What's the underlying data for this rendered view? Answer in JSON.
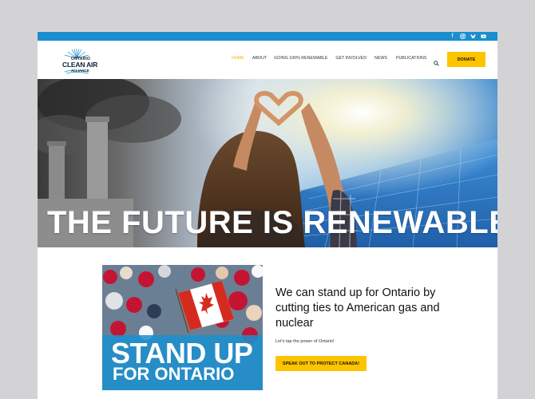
{
  "social": {
    "icons": [
      "facebook-icon",
      "instagram-icon",
      "bluesky-icon",
      "youtube-icon"
    ],
    "facebook_glyph": "f"
  },
  "logo": {
    "line1": "ONTARIO",
    "line2": "CLEAN AIR",
    "line3": "ALLIANCE"
  },
  "nav": {
    "items": [
      {
        "label": "HOME",
        "active": true
      },
      {
        "label": "ABOUT"
      },
      {
        "label": "GOING 100% RENEWABLE"
      },
      {
        "label": "GET INVOLVED"
      },
      {
        "label": "NEWS"
      },
      {
        "label": "PUBLICATIONS"
      }
    ],
    "search_icon": "search-icon",
    "donate_label": "DONATE"
  },
  "hero": {
    "title": "THE FUTURE IS RENEWABLE"
  },
  "promo": {
    "line1": "STAND UP",
    "line2": "FOR ONTARIO"
  },
  "main": {
    "headline": "We can stand up for Ontario by cutting ties to American gas and nuclear",
    "subtext": "Let's tap the power of Ontario!",
    "cta_label": "SPEAK OUT TO PROTECT CANADA!"
  },
  "colors": {
    "topbar": "#1a8fd0",
    "accent_yellow": "#ffc400",
    "nav_active": "#f5b400"
  }
}
